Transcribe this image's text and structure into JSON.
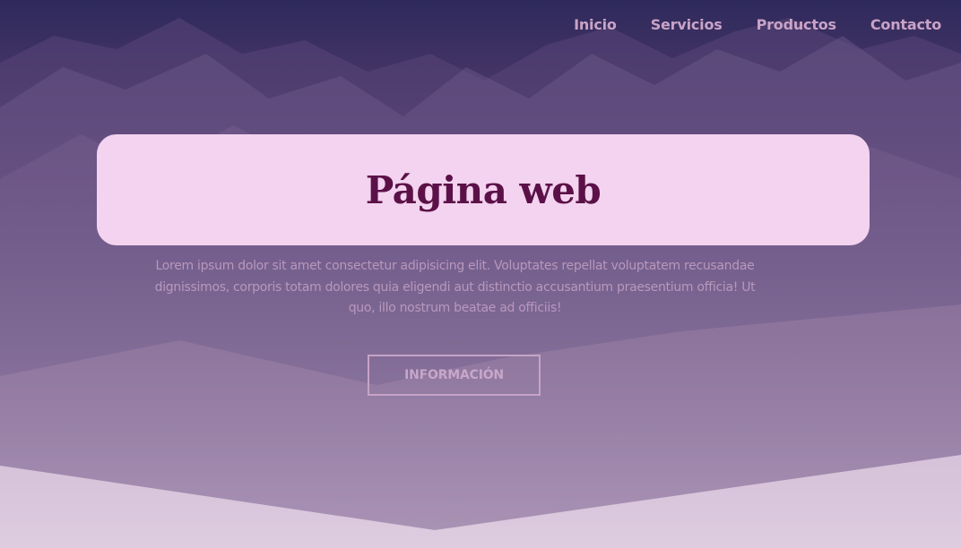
{
  "nav": {
    "items": [
      {
        "label": "Inicio"
      },
      {
        "label": "Servicios"
      },
      {
        "label": "Productos"
      },
      {
        "label": "Contacto"
      }
    ]
  },
  "hero": {
    "title": "Página web",
    "description": "Lorem ipsum dolor sit amet consectetur adipisicing elit. Voluptates repellat voluptatem recusandae dignissimos, corporis totam dolores quia eligendi aut distinctio accusantium praesentium officia! Ut quo, illo nostrum beatae ad officiis!",
    "button_label": "INFORMACIÓN"
  },
  "colors": {
    "title_card_bg": "#f3d3ef",
    "title_text": "#5b1147",
    "nav_text": "#c9a3c6",
    "overlay_top": "#2f2a5c",
    "overlay_bottom": "#e4d2e4"
  }
}
